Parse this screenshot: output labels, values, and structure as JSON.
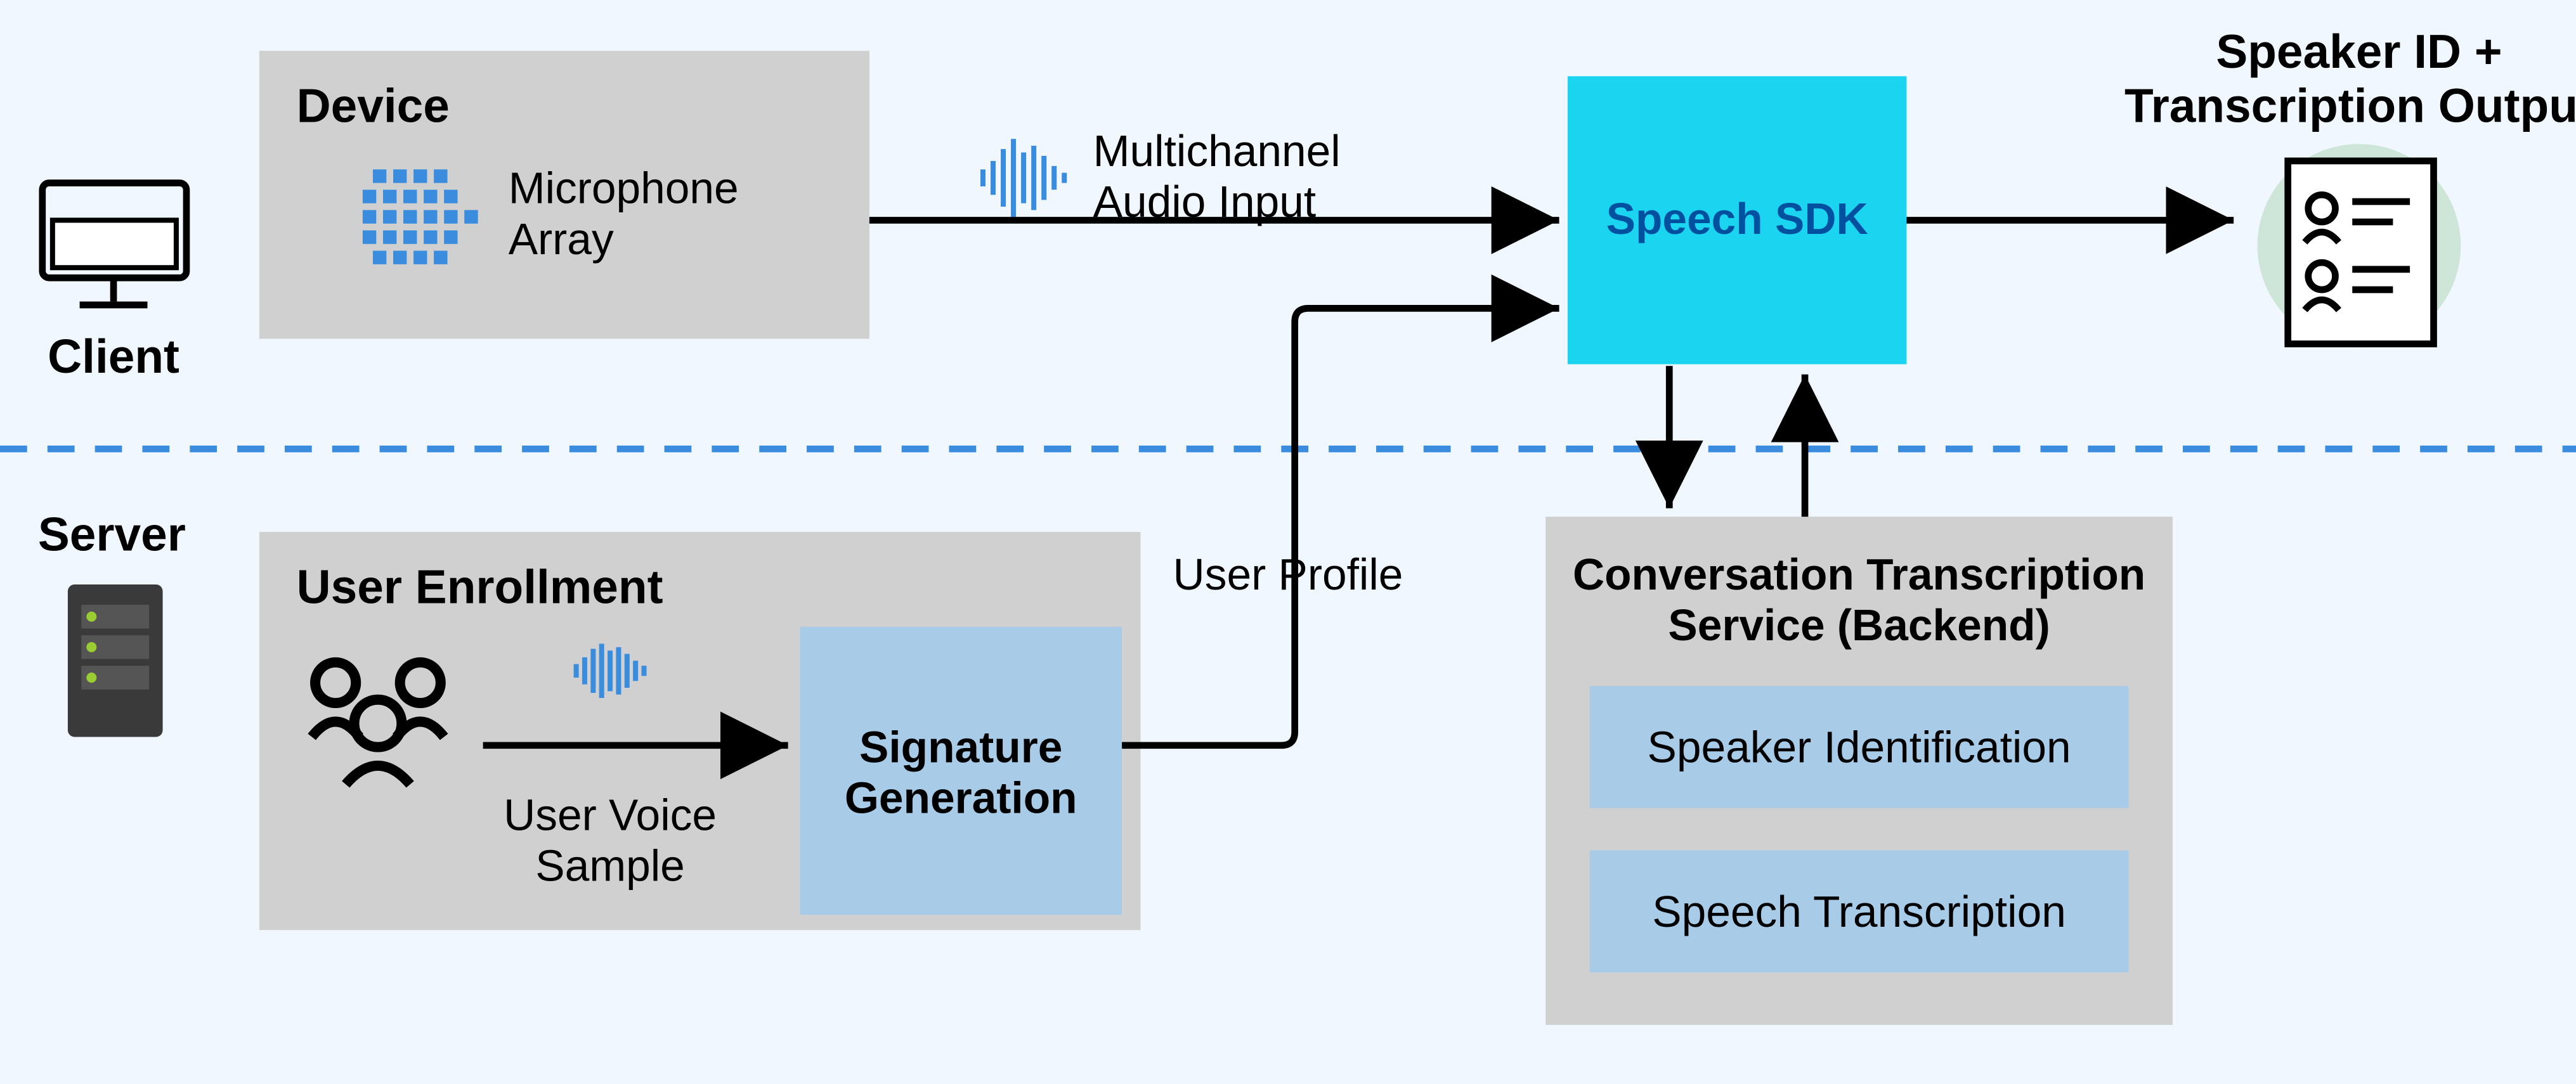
{
  "client_label": "Client",
  "server_label": "Server",
  "device": {
    "title": "Device",
    "mic_label": "Microphone\nArray"
  },
  "audio_input_label": "Multichannel\nAudio Input",
  "speech_sdk_label": "Speech SDK",
  "output_title": "Speaker ID +\nTranscription Output",
  "user_enrollment": {
    "title": "User Enrollment",
    "voice_sample_label": "User Voice\nSample",
    "sig_gen_label": "Signature\nGeneration"
  },
  "user_profile_label": "User Profile",
  "backend": {
    "title": "Conversation Transcription\nService (Backend)",
    "speaker_id": "Speaker Identification",
    "speech_trans": "Speech Transcription"
  }
}
